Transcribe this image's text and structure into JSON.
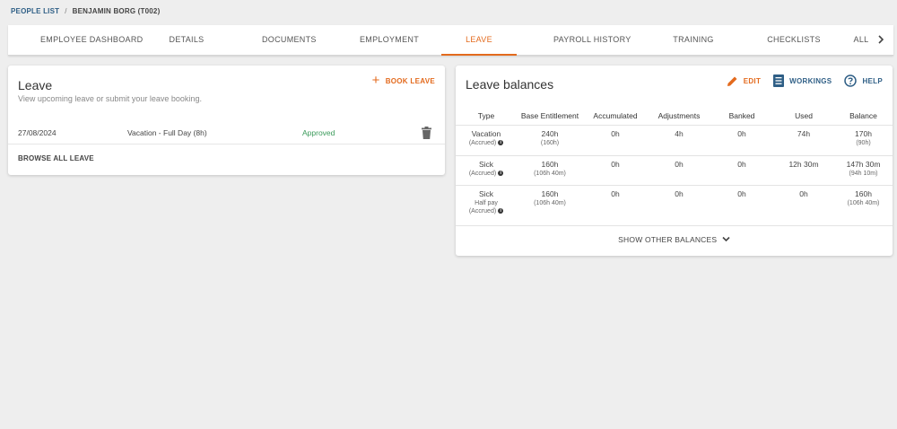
{
  "breadcrumb": {
    "root": "PEOPLE LIST",
    "separator": "/",
    "current": "BENJAMIN BORG (T002)"
  },
  "tabs": [
    {
      "label": "EMPLOYEE DASHBOARD"
    },
    {
      "label": "DETAILS"
    },
    {
      "label": "DOCUMENTS"
    },
    {
      "label": "EMPLOYMENT"
    },
    {
      "label": "LEAVE",
      "active": true
    },
    {
      "label": "PAYROLL HISTORY"
    },
    {
      "label": "TRAINING"
    },
    {
      "label": "CHECKLISTS"
    },
    {
      "label": "ALL"
    }
  ],
  "leave": {
    "title": "Leave",
    "subtitle": "View upcoming leave or submit your leave booking.",
    "book_label": "BOOK LEAVE",
    "entry": {
      "date": "27/08/2024",
      "type": "Vacation - Full Day (8h)",
      "status": "Approved"
    },
    "browse_label": "BROWSE ALL LEAVE"
  },
  "balances": {
    "title": "Leave balances",
    "edit_label": "EDIT",
    "workings_label": "WORKINGS",
    "help_label": "HELP",
    "columns": [
      "Type",
      "Base Entitlement",
      "Accumulated",
      "Adjustments",
      "Banked",
      "Used",
      "Balance"
    ],
    "rows": [
      {
        "type": "Vacation",
        "type_sub": "(Accrued)",
        "base": "240h",
        "base_sub": "(160h)",
        "accumulated": "0h",
        "adjustments": "4h",
        "banked": "0h",
        "used": "74h",
        "balance": "170h",
        "balance_sub": "(90h)"
      },
      {
        "type": "Sick",
        "type_sub": "(Accrued)",
        "base": "160h",
        "base_sub": "(106h 40m)",
        "accumulated": "0h",
        "adjustments": "0h",
        "banked": "0h",
        "used": "12h 30m",
        "balance": "147h 30m",
        "balance_sub": "(94h 10m)"
      },
      {
        "type": "Sick",
        "type_mid": "Half pay",
        "type_sub": "(Accrued)",
        "base": "160h",
        "base_sub": "(106h 40m)",
        "accumulated": "0h",
        "adjustments": "0h",
        "banked": "0h",
        "used": "0h",
        "balance": "160h",
        "balance_sub": "(106h 40m)"
      }
    ],
    "show_other_label": "SHOW OTHER BALANCES"
  },
  "colors": {
    "accent": "#e36a1d",
    "link": "#2f5f86",
    "approved": "#3a9a5a"
  }
}
